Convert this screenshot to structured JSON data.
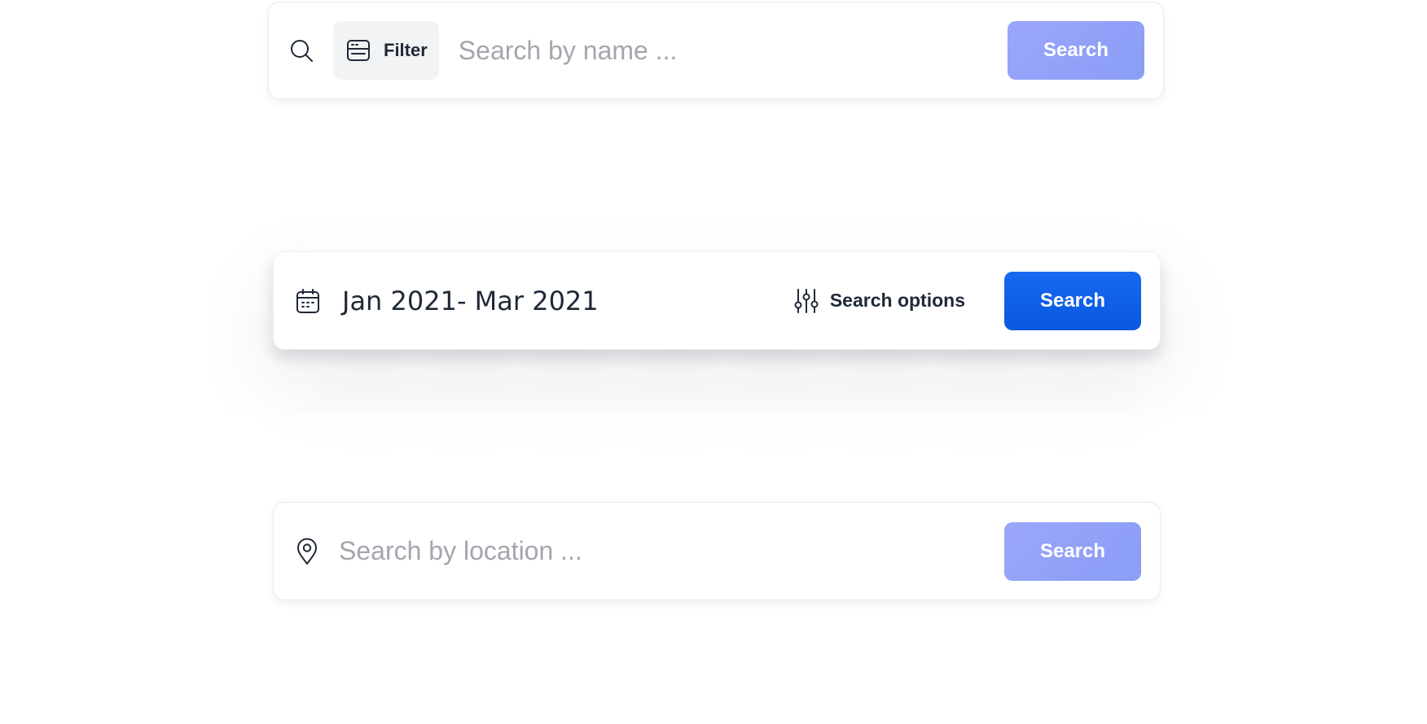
{
  "search_bars": [
    {
      "search_icon": "search-icon",
      "filter": {
        "icon": "window-filter-icon",
        "label": "Filter"
      },
      "input": {
        "value": "",
        "placeholder": "Search by name ..."
      },
      "button": {
        "label": "Search",
        "state": "disabled",
        "color": "#8FA0F8"
      }
    },
    {
      "calendar_icon": "calendar-icon",
      "date_range": "Jan 2021- Mar 2021",
      "options": {
        "icon": "sliders-icon",
        "label": "Search options"
      },
      "button": {
        "label": "Search",
        "state": "active",
        "color": "#0B5CE8"
      }
    },
    {
      "location_icon": "map-pin-icon",
      "input": {
        "value": "",
        "placeholder": "Search by location ..."
      },
      "button": {
        "label": "Search",
        "state": "disabled",
        "color": "#8FA0F8"
      }
    }
  ],
  "colors": {
    "text_dark": "#1F2937",
    "placeholder": "#A3A6AD",
    "chip_background": "#F2F3F5",
    "primary_blue": "#0B5CE8",
    "soft_blue": "#8FA0F8"
  }
}
